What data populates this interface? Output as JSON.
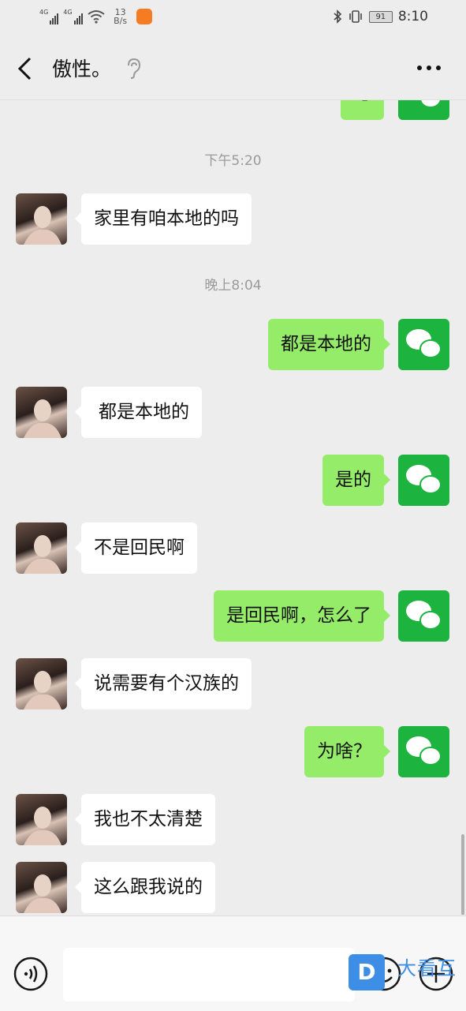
{
  "status_bar": {
    "signal1": "4G",
    "signal2": "4G",
    "speed_value": "13",
    "speed_unit": "B/s",
    "battery": "91",
    "time": "8:10"
  },
  "header": {
    "title": "傲性。"
  },
  "messages": [
    {
      "side": "right",
      "text": "嗯"
    },
    {
      "timestamp": "下午5:20"
    },
    {
      "side": "left",
      "text": "家里有咱本地的吗"
    },
    {
      "timestamp": "晚上8:04"
    },
    {
      "side": "right",
      "text": "都是本地的"
    },
    {
      "side": "left",
      "text": "  都是本地的"
    },
    {
      "side": "right",
      "text": "是的"
    },
    {
      "side": "left",
      "text": "不是回民啊"
    },
    {
      "side": "right",
      "text": "是回民啊，怎么了"
    },
    {
      "side": "left",
      "text": "说需要有个汉族的"
    },
    {
      "side": "right",
      "text": "为啥？"
    },
    {
      "side": "left",
      "text": "我也不太清楚"
    },
    {
      "side": "left",
      "text": "这么跟我说的"
    },
    {
      "side": "right",
      "text": ""
    }
  ],
  "watermark": {
    "logo": "D",
    "text": "大看互"
  },
  "colors": {
    "sent_bubble": "#95ec69",
    "received_bubble": "#ffffff",
    "wechat_green": "#1db33f",
    "background": "#ededed"
  }
}
